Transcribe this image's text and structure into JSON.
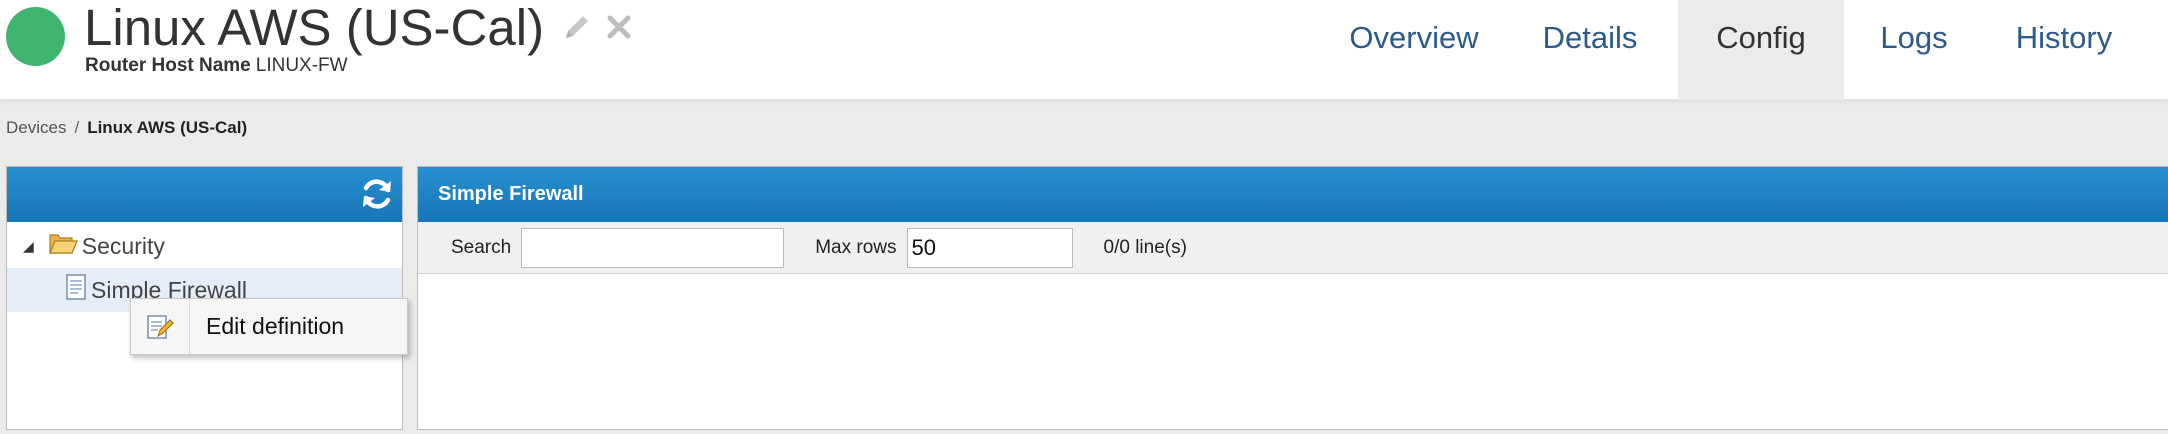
{
  "header": {
    "title": "Linux AWS (US-Cal)",
    "host_label": "Router Host Name",
    "host_value": "LINUX-FW",
    "status_color": "#3eb46f",
    "icons": [
      "pencil-icon",
      "close-icon"
    ]
  },
  "tabs": [
    {
      "label": "Overview",
      "active": false
    },
    {
      "label": "Details",
      "active": false
    },
    {
      "label": "Config",
      "active": true
    },
    {
      "label": "Logs",
      "active": false
    },
    {
      "label": "History",
      "active": false
    }
  ],
  "breadcrumb": {
    "root": "Devices",
    "separator": "/",
    "current": "Linux AWS (US-Cal)"
  },
  "tree": {
    "refresh_icon": "refresh-icon",
    "folder": {
      "label": "Security",
      "expanded": true
    },
    "item": {
      "label": "Simple Firewall",
      "selected": true
    }
  },
  "context_menu": {
    "items": [
      {
        "label": "Edit definition",
        "icon": "edit-document-icon"
      }
    ]
  },
  "main": {
    "title": "Simple Firewall",
    "search_label": "Search",
    "search_value": "",
    "maxrows_label": "Max rows",
    "maxrows_value": "50",
    "lines_count": "0/0 line(s)"
  },
  "colors": {
    "accent_blue": "#1e84c4",
    "tab_text": "#2b5a8c"
  }
}
